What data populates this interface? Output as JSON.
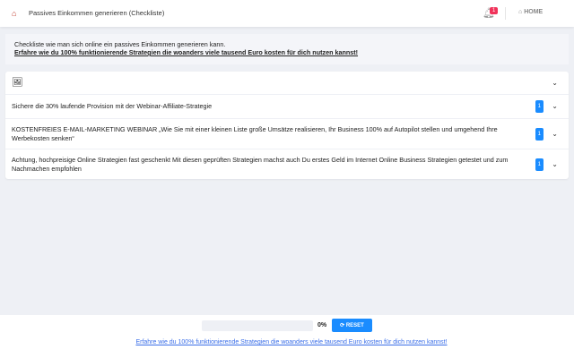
{
  "header": {
    "title": "Passives Einkommen generieren (Checkliste)",
    "notifications": "1",
    "home": "HOME"
  },
  "intro": {
    "text": "Checkliste wie man sich online ein passives Einkommen generieren kann.",
    "link": "Erfahre wie du 100% funktionierende Strategien die woanders viele tausend Euro kosten für dich nutzen kannst!"
  },
  "items": [
    {
      "text": "Sichere die 30% laufende Provision mit der Webinar-Affiliate-Strategie",
      "count": "1"
    },
    {
      "text": "KOSTENFREIES E-MAIL-MARKETING WEBINAR „Wie Sie mit einer kleinen Liste große Umsätze realisieren, Ihr Business 100% auf Autopilot stellen und umgehend Ihre Werbekosten senken“",
      "count": "1"
    },
    {
      "text": "Achtung, hochpreisige Online Strategien fast geschenkt Mit diesen geprüften Strategien machst auch Du erstes Geld im Internet Online Business Strategien getestet und zum Nachmachen empfohlen",
      "count": "1"
    }
  ],
  "footer": {
    "progress_percent": 0,
    "progress_label": "0%",
    "reset": "RESET",
    "link": "Erfahre wie du 100% funktionierende Strategien die woanders viele tausend Euro kosten für dich nutzen kannst!"
  }
}
